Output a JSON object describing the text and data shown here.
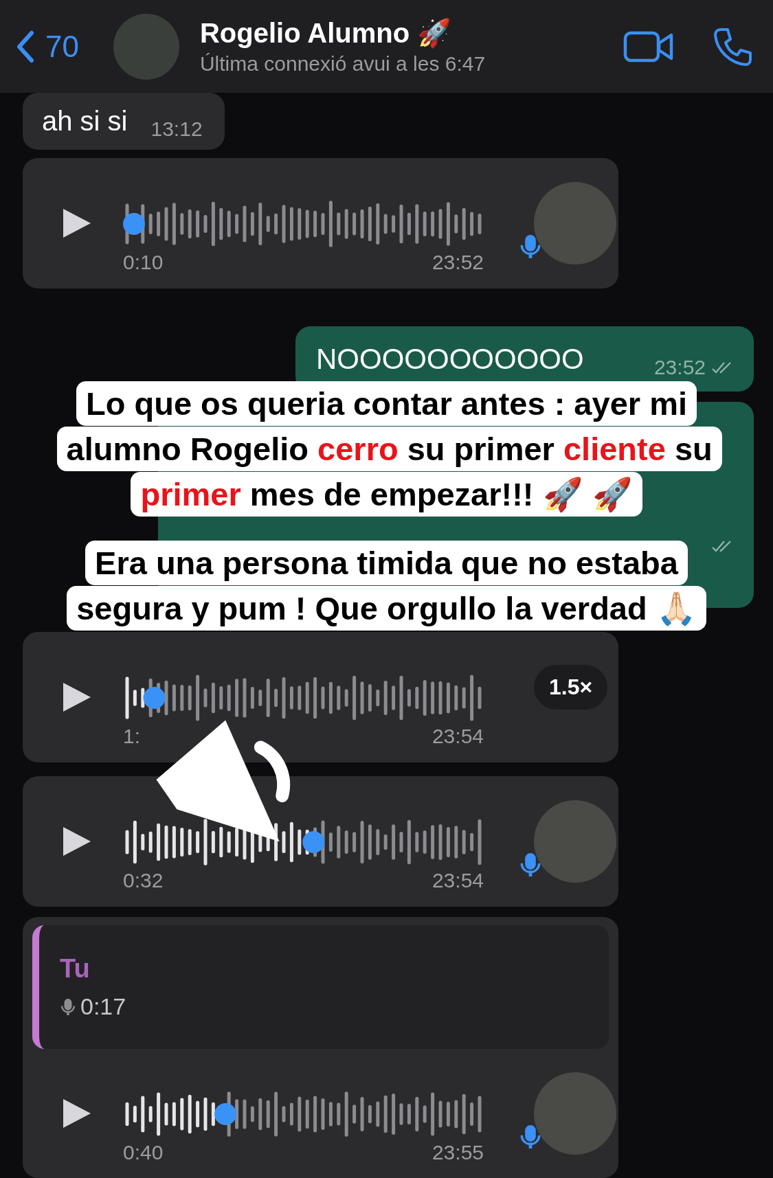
{
  "header": {
    "back_count": "70",
    "name": "Rogelio Alumno 🚀",
    "status": "Última connexió avui a les 6:47"
  },
  "messages": [
    {
      "kind": "text_in",
      "text": "ah si si",
      "time": "13:12"
    },
    {
      "kind": "voice",
      "duration": "0:10",
      "time": "23:52",
      "level": 0
    },
    {
      "kind": "text_out",
      "text": "NOOOOOOOOOOO",
      "time": "23:52"
    },
    {
      "kind": "covered_out"
    },
    {
      "kind": "voice_speed",
      "duration": "1:",
      "time": "23:54",
      "level": 0.06,
      "speed": "1.5×"
    },
    {
      "kind": "voice",
      "duration": "0:32",
      "time": "23:54",
      "level": 0.53
    },
    {
      "kind": "reply",
      "quote": {
        "author": "Tu",
        "duration": "0:17"
      },
      "voice": {
        "kind": "voice",
        "duration": "0:40",
        "time": "23:55",
        "level": 0.27
      }
    }
  ],
  "captions": [
    {
      "segments": [
        {
          "text": "Lo que os queria contar antes : ayer mi alumno Rogelio ",
          "highlight": false
        },
        {
          "text": "cerro",
          "highlight": true
        },
        {
          "text": " su primer ",
          "highlight": false
        },
        {
          "text": "cliente",
          "highlight": true
        },
        {
          "text": " su ",
          "highlight": false
        },
        {
          "text": "primer",
          "highlight": true
        },
        {
          "text": " mes de empezar!!! 🚀 🚀",
          "highlight": false
        }
      ]
    },
    {
      "segments": [
        {
          "text": "Era una persona timida que no estaba segura y pum ! Que orgullo la verdad 🙏🏻",
          "highlight": false
        }
      ]
    }
  ]
}
